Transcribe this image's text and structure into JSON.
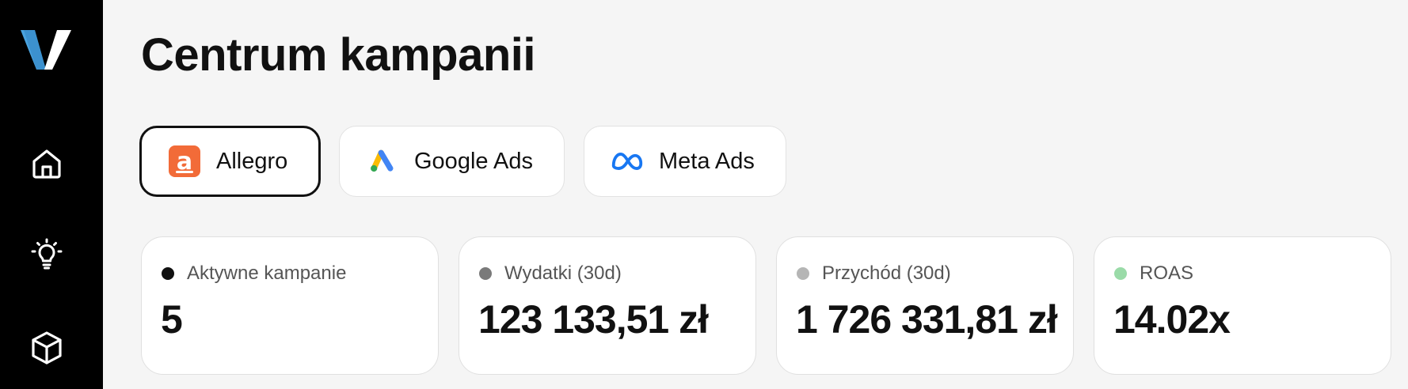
{
  "sidebar": {
    "logo_letter": "V",
    "nav": [
      {
        "name": "home-icon"
      },
      {
        "name": "lightbulb-icon"
      },
      {
        "name": "cube-icon"
      }
    ]
  },
  "header": {
    "title": "Centrum kampanii"
  },
  "tabs": [
    {
      "label": "Allegro",
      "icon": "allegro-logo-icon",
      "active": true
    },
    {
      "label": "Google Ads",
      "icon": "google-ads-logo-icon",
      "active": false
    },
    {
      "label": "Meta Ads",
      "icon": "meta-logo-icon",
      "active": false
    }
  ],
  "stats": [
    {
      "label": "Aktywne kampanie",
      "value": "5",
      "dot_color": "#111111"
    },
    {
      "label": "Wydatki (30d)",
      "value": "123 133,51 zł",
      "dot_color": "#7a7a7a"
    },
    {
      "label": "Przychód (30d)",
      "value": "1 726 331,81 zł",
      "dot_color": "#b5b5b5"
    },
    {
      "label": "ROAS",
      "value": "14.02x",
      "dot_color": "#9adba8"
    }
  ],
  "colors": {
    "sidebar_bg": "#000000",
    "page_bg": "#f5f5f5",
    "allegro_orange": "#f26b38",
    "logo_blue": "#4aa3df"
  }
}
